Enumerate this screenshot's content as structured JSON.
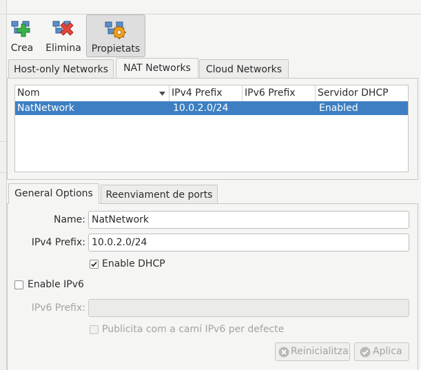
{
  "toolbar": {
    "create_label": "Crea",
    "delete_label": "Elimina",
    "properties_label": "Propietats"
  },
  "network_tabs": {
    "host_only": "Host-only Networks",
    "nat": "NAT Networks",
    "cloud": "Cloud Networks"
  },
  "table": {
    "columns": [
      "Nom",
      "IPv4 Prefix",
      "IPv6 Prefix",
      "Servidor DHCP"
    ],
    "rows": [
      {
        "name": "NatNetwork",
        "ipv4": "10.0.2.0/24",
        "ipv6": "",
        "dhcp": "Enabled"
      }
    ]
  },
  "detail_tabs": {
    "general": "General Options",
    "port_forwarding": "Reenviament de ports"
  },
  "form": {
    "name_label": "Name:",
    "name_value": "NatNetwork",
    "ipv4_label": "IPv4 Prefix:",
    "ipv4_value": "10.0.2.0/24",
    "enable_dhcp_label": "Enable DHCP",
    "enable_dhcp_checked": true,
    "enable_ipv6_label": "Enable IPv6",
    "enable_ipv6_checked": false,
    "ipv6_label": "IPv6 Prefix:",
    "ipv6_value": "",
    "advertise_default_route_label": "Publicita com a camí IPv6 per defecte",
    "advertise_default_route_checked": false
  },
  "buttons": {
    "reset_label": "Reinicialitza",
    "apply_label": "Aplica"
  },
  "icons": {
    "create": "network-add-icon",
    "delete": "network-remove-icon",
    "properties": "network-properties-icon",
    "reset": "reset-icon",
    "apply": "apply-icon",
    "sort": "sort-descending-icon"
  },
  "colors": {
    "selection": "#3d7fc2",
    "add_green": "#3bb14a",
    "remove_red": "#e2463b",
    "gear_orange": "#f0a020"
  }
}
